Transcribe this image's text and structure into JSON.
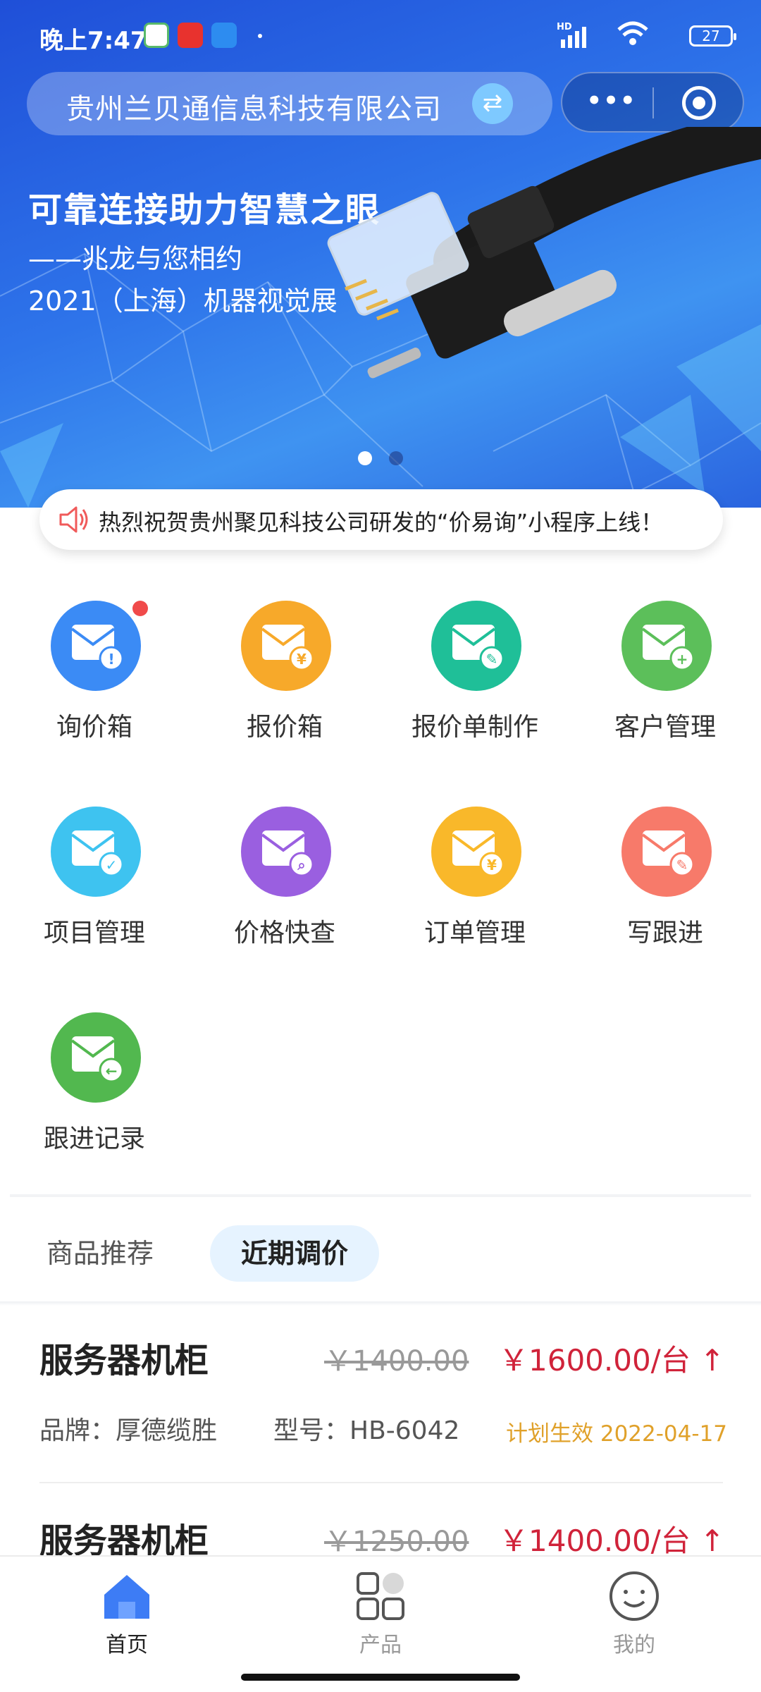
{
  "status_bar": {
    "time": "晚上7:47",
    "battery": "27",
    "network": "HD"
  },
  "header": {
    "company_name": "贵州兰贝通信息科技有限公司",
    "swap_icon": "swap-icon",
    "more_icon": "more-dots-icon",
    "close_icon": "target-icon"
  },
  "banner": {
    "headline": "可靠连接助力智慧之眼",
    "subline1": "——兆龙与您相约",
    "subline2": "2021（上海）机器视觉展",
    "slide_count": 2,
    "active_slide": 1
  },
  "notice": {
    "icon": "speaker-icon",
    "text": "热烈祝贺贵州聚见科技公司研发的“价易询”小程序上线！"
  },
  "menu": [
    {
      "label": "询价箱",
      "icon": "inquiry-box-icon",
      "color": "#3b8bf5",
      "badge": true
    },
    {
      "label": "报价箱",
      "icon": "quote-box-icon",
      "color": "#f7a92a",
      "badge": false
    },
    {
      "label": "报价单制作",
      "icon": "quote-make-icon",
      "color": "#1fbf98",
      "badge": false
    },
    {
      "label": "客户管理",
      "icon": "customer-icon",
      "color": "#5cbf5a",
      "badge": false
    },
    {
      "label": "项目管理",
      "icon": "project-icon",
      "color": "#3ec3f0",
      "badge": false
    },
    {
      "label": "价格快查",
      "icon": "price-search-icon",
      "color": "#9a5fe0",
      "badge": false
    },
    {
      "label": "订单管理",
      "icon": "order-icon",
      "color": "#f9b82a",
      "badge": false
    },
    {
      "label": "写跟进",
      "icon": "follow-write-icon",
      "color": "#f77a6a",
      "badge": false
    },
    {
      "label": "跟进记录",
      "icon": "follow-record-icon",
      "color": "#52b84f",
      "badge": false
    }
  ],
  "tabs": {
    "recommend": "商品推荐",
    "price_adjust": "近期调价",
    "active": "price_adjust"
  },
  "products": [
    {
      "name": "服务器机柜",
      "old_price": "￥1400.00",
      "new_price": "￥1600.00/台 ↑",
      "brand": "品牌：厚德缆胜",
      "model": "型号：HB-6042",
      "effective": "计划生效 2022-04-17"
    },
    {
      "name": "服务器机柜",
      "old_price": "￥1250.00",
      "new_price": "￥1400.00/台 ↑"
    }
  ],
  "bottom_nav": [
    {
      "label": "首页",
      "icon": "home-icon",
      "active": true
    },
    {
      "label": "产品",
      "icon": "products-icon",
      "active": false
    },
    {
      "label": "我的",
      "icon": "profile-icon",
      "active": false
    }
  ]
}
